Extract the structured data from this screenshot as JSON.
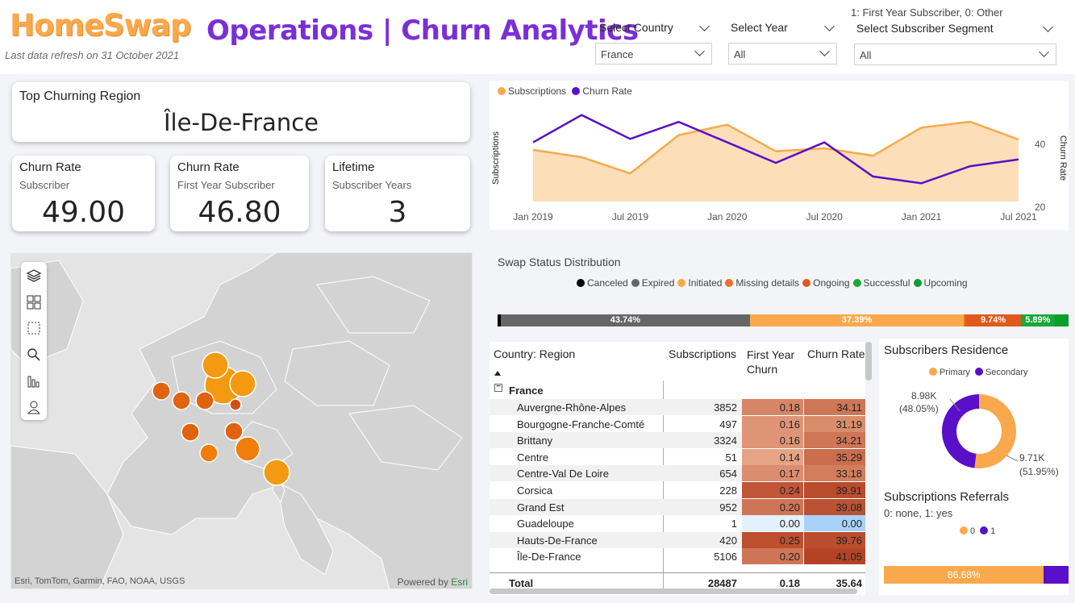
{
  "header": {
    "logo": "HomeSwap",
    "refresh": "Last data refresh on 31 October 2021",
    "title": "Operations | Churn Analytics"
  },
  "slicers": {
    "country": {
      "label": "Select Country",
      "value": "France"
    },
    "year": {
      "label": "Select Year",
      "value": "All"
    },
    "segment": {
      "note": "1: First Year Subscriber, 0: Other",
      "label": "Select Subscriber Segment",
      "value": "All"
    }
  },
  "kpis": {
    "top_region": {
      "title": "Top Churning Region",
      "value": "Île-De-France"
    },
    "churn_sub": {
      "title": "Churn Rate",
      "sub": "Subscriber",
      "value": "49.00"
    },
    "churn_first": {
      "title": "Churn Rate",
      "sub": "First Year Subscriber",
      "value": "46.80"
    },
    "lifetime": {
      "title": "Lifetime",
      "sub": "Subscriber Years",
      "value": "3"
    }
  },
  "map": {
    "attribution": "Esri, TomTom, Garmin, FAO, NOAA, USGS",
    "powered_by": "Powered by",
    "powered_brand": "Esri",
    "tools": [
      "layers-icon",
      "grid-select-icon",
      "rect-select-icon",
      "search-icon",
      "chart-icon",
      "person-icon"
    ]
  },
  "line_chart": {
    "legend": [
      "Subscriptions",
      "Churn Rate"
    ],
    "ylabel_left": "Subscriptions",
    "ylabel_right": "Churn Rate",
    "yticks_right": [
      "40",
      "20"
    ],
    "xticks": [
      "Jan 2019",
      "Jul 2019",
      "Jan 2020",
      "Jul 2020",
      "Jan 2021",
      "Jul 2021"
    ]
  },
  "chart_data": [
    {
      "type": "area",
      "title": "",
      "x": [
        "Jan 2019",
        "Apr 2019",
        "Jul 2019",
        "Oct 2019",
        "Jan 2020",
        "Apr 2020",
        "Jul 2020",
        "Oct 2020",
        "Jan 2021",
        "Apr 2021",
        "Jul 2021"
      ],
      "series": [
        {
          "name": "Subscriptions",
          "type": "area",
          "color": "#f9a94b",
          "values": [
            35,
            30,
            19,
            45,
            52,
            34,
            36,
            31,
            50,
            54,
            42
          ]
        },
        {
          "name": "Churn Rate",
          "type": "line",
          "color": "#5a0fc8",
          "axis": "right",
          "values": [
            39,
            47,
            40,
            45,
            39,
            33,
            39,
            29,
            27,
            32,
            34
          ]
        }
      ],
      "xlabel": "",
      "ylabel": "Subscriptions",
      "y2label": "Churn Rate",
      "y2lim": [
        20,
        50
      ]
    },
    {
      "type": "bar",
      "title": "Swap Status Distribution",
      "categories": [
        "Canceled",
        "Expired",
        "Initiated",
        "Missing details",
        "Ongoing",
        "Successful",
        "Upcoming"
      ],
      "values": [
        0.5,
        43.74,
        37.39,
        0.3,
        9.74,
        5.89,
        2.44
      ],
      "labels": [
        "",
        "43.74%",
        "37.39%",
        "",
        "9.74%",
        "5.89%",
        ""
      ],
      "colors": [
        "#000000",
        "#666666",
        "#f9a94b",
        "#e8702a",
        "#e05a1c",
        "#1aa83a",
        "#0c9e2a"
      ]
    },
    {
      "type": "pie",
      "title": "Subscribers Residence",
      "categories": [
        "Primary",
        "Secondary"
      ],
      "values": [
        9.71,
        8.98
      ],
      "labels": [
        "9.71K\n(51.95%)",
        "8.98K\n(48.05%)"
      ],
      "colors": [
        "#f9a94b",
        "#5a0fc8"
      ]
    },
    {
      "type": "bar",
      "title": "Subscriptions Referrals",
      "subtitle": "0: none, 1: yes",
      "categories": [
        "0",
        "1"
      ],
      "values": [
        86.68,
        13.32
      ],
      "labels": [
        "86.68%",
        ""
      ],
      "colors": [
        "#f9a94b",
        "#5a0fc8"
      ]
    }
  ],
  "swap_status": {
    "title": "Swap Status Distribution",
    "legend": [
      {
        "label": "Canceled",
        "color": "#000000"
      },
      {
        "label": "Expired",
        "color": "#666666"
      },
      {
        "label": "Initiated",
        "color": "#f9a94b"
      },
      {
        "label": "Missing details",
        "color": "#e8702a"
      },
      {
        "label": "Ongoing",
        "color": "#e05a1c"
      },
      {
        "label": "Successful",
        "color": "#1aa83a"
      },
      {
        "label": "Upcoming",
        "color": "#0c9e2a"
      }
    ]
  },
  "table": {
    "headers": [
      "Country: Region",
      "Subscriptions",
      "First Year Churn",
      "Churn Rate"
    ],
    "group": "France",
    "rows": [
      [
        "Auvergne-Rhône-Alpes",
        "3852",
        "0.18",
        "34.11"
      ],
      [
        "Bourgogne-Franche-Comté",
        "497",
        "0.16",
        "31.19"
      ],
      [
        "Brittany",
        "3324",
        "0.16",
        "34.21"
      ],
      [
        "Centre",
        "51",
        "0.14",
        "35.29"
      ],
      [
        "Centre-Val De Loire",
        "654",
        "0.17",
        "33.18"
      ],
      [
        "Corsica",
        "228",
        "0.24",
        "39.91"
      ],
      [
        "Grand Est",
        "952",
        "0.20",
        "39.08"
      ],
      [
        "Guadeloupe",
        "1",
        "0.00",
        "0.00"
      ],
      [
        "Hauts-De-France",
        "420",
        "0.25",
        "39.76"
      ],
      [
        "Île-De-France",
        "5106",
        "0.20",
        "41.05"
      ]
    ],
    "total": [
      "Total",
      "28487",
      "0.18",
      "35.64"
    ]
  },
  "residence": {
    "title": "Subscribers Residence",
    "legend": [
      "Primary",
      "Secondary"
    ],
    "label_secondary_1": "8.98K",
    "label_secondary_2": "(48.05%)",
    "label_primary_1": "9.71K",
    "label_primary_2": "(51.95%)"
  },
  "referrals": {
    "title": "Subscriptions Referrals",
    "subtitle": "0: none, 1: yes",
    "legend": [
      "0",
      "1"
    ],
    "bar_label": "86.68%"
  }
}
